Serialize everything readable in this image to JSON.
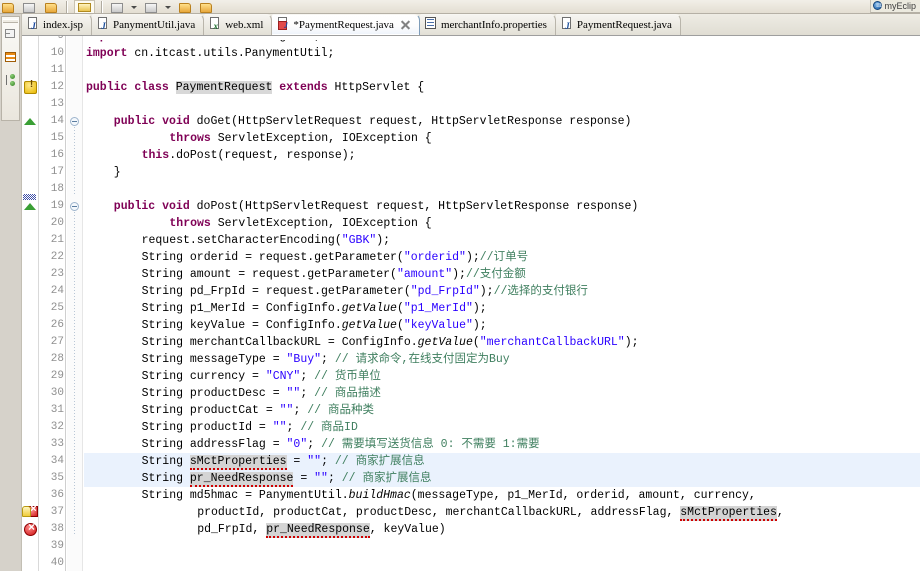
{
  "window": {
    "brand": "myEclip",
    "brand_icon": "myeclipse-globe-icon"
  },
  "toolbar": {
    "icons": [
      {
        "name": "open-folder-icon",
        "kind": "folder"
      },
      {
        "name": "new-wizard-icon",
        "kind": "gray"
      },
      {
        "name": "save-icon",
        "kind": "folder"
      },
      {
        "name": "edit-pencil-icon",
        "kind": "pencil"
      },
      {
        "name": "deploy-icon",
        "kind": "gray"
      },
      {
        "name": "server-icon",
        "kind": "gray"
      },
      {
        "name": "back-icon",
        "kind": "folder"
      },
      {
        "name": "forward-icon",
        "kind": "folder"
      }
    ]
  },
  "fastview": {
    "items": [
      {
        "name": "outline-view-icon",
        "kind": "outline"
      },
      {
        "name": "database-explorer-icon",
        "kind": "grid"
      },
      {
        "name": "package-explorer-icon",
        "kind": "tree"
      }
    ]
  },
  "tabs": [
    {
      "label": "index.jsp",
      "icon": "jsp-file-icon",
      "icon_kind": "jsp",
      "active": false,
      "dirty": false,
      "closable": false
    },
    {
      "label": "PanymentUtil.java",
      "icon": "java-file-icon",
      "icon_kind": "java",
      "active": false,
      "dirty": false,
      "closable": false
    },
    {
      "label": "web.xml",
      "icon": "xml-file-icon",
      "icon_kind": "xml",
      "active": false,
      "dirty": false,
      "closable": false
    },
    {
      "label": "*PaymentRequest.java",
      "icon": "java-file-dirty-icon",
      "icon_kind": "java-dirty",
      "active": true,
      "dirty": true,
      "closable": true
    },
    {
      "label": "merchantInfo.properties",
      "icon": "properties-file-icon",
      "icon_kind": "props",
      "active": false,
      "dirty": false,
      "closable": false
    },
    {
      "label": "PaymentRequest.java",
      "icon": "java-file-icon",
      "icon_kind": "java",
      "active": false,
      "dirty": false,
      "closable": false
    }
  ],
  "editor": {
    "first_line": 9,
    "last_line": 40,
    "highlighted_lines": [
      34,
      35
    ],
    "markers": [
      {
        "line": 12,
        "kind": "warning",
        "name": "warning-marker-icon"
      },
      {
        "line": 37,
        "kind": "error-quickfix",
        "name": "error-quickfix-marker-icon"
      },
      {
        "line": 38,
        "kind": "error",
        "name": "error-marker-icon"
      }
    ],
    "fold_markers": [
      14,
      19
    ],
    "override_markers": [
      14,
      19
    ],
    "lines": [
      {
        "n": 9,
        "indent": 0,
        "text": "import cn.itcast.utils.ConfigInfo;"
      },
      {
        "n": 10,
        "indent": 0,
        "text": "import cn.itcast.utils.PanymentUtil;"
      },
      {
        "n": 11,
        "indent": 0,
        "text": ""
      },
      {
        "n": 12,
        "indent": 0,
        "text": "public class PaymentRequest extends HttpServlet {"
      },
      {
        "n": 13,
        "indent": 0,
        "text": ""
      },
      {
        "n": 14,
        "indent": 1,
        "text": "public void doGet(HttpServletRequest request, HttpServletResponse response)"
      },
      {
        "n": 15,
        "indent": 3,
        "text": "throws ServletException, IOException {"
      },
      {
        "n": 16,
        "indent": 2,
        "text": "this.doPost(request, response);"
      },
      {
        "n": 17,
        "indent": 1,
        "text": "}"
      },
      {
        "n": 18,
        "indent": 0,
        "text": ""
      },
      {
        "n": 19,
        "indent": 1,
        "text": "public void doPost(HttpServletRequest request, HttpServletResponse response)"
      },
      {
        "n": 20,
        "indent": 3,
        "text": "throws ServletException, IOException {"
      },
      {
        "n": 21,
        "indent": 2,
        "text": "request.setCharacterEncoding(\"GBK\");"
      },
      {
        "n": 22,
        "indent": 2,
        "text": "String orderid = request.getParameter(\"orderid\");//订单号"
      },
      {
        "n": 23,
        "indent": 2,
        "text": "String amount = request.getParameter(\"amount\");//支付金额"
      },
      {
        "n": 24,
        "indent": 2,
        "text": "String pd_FrpId = request.getParameter(\"pd_FrpId\");//选择的支付银行"
      },
      {
        "n": 25,
        "indent": 2,
        "text": "String p1_MerId = ConfigInfo.getValue(\"p1_MerId\");"
      },
      {
        "n": 26,
        "indent": 2,
        "text": "String keyValue = ConfigInfo.getValue(\"keyValue\");"
      },
      {
        "n": 27,
        "indent": 2,
        "text": "String merchantCallbackURL = ConfigInfo.getValue(\"merchantCallbackURL\");"
      },
      {
        "n": 28,
        "indent": 2,
        "text": "String messageType = \"Buy\"; // 请求命令,在线支付固定为Buy"
      },
      {
        "n": 29,
        "indent": 2,
        "text": "String currency = \"CNY\"; // 货币单位"
      },
      {
        "n": 30,
        "indent": 2,
        "text": "String productDesc = \"\"; // 商品描述"
      },
      {
        "n": 31,
        "indent": 2,
        "text": "String productCat = \"\"; // 商品种类"
      },
      {
        "n": 32,
        "indent": 2,
        "text": "String productId = \"\"; // 商品ID"
      },
      {
        "n": 33,
        "indent": 2,
        "text": "String addressFlag = \"0\"; // 需要填写送货信息 0: 不需要 1:需要"
      },
      {
        "n": 34,
        "indent": 2,
        "text": "String sMctProperties = \"\"; // 商家扩展信息"
      },
      {
        "n": 35,
        "indent": 2,
        "text": "String pr_NeedResponse = \"\"; // 商家扩展信息"
      },
      {
        "n": 36,
        "indent": 2,
        "text": "String md5hmac = PanymentUtil.buildHmac(messageType, p1_MerId, orderid, amount, currency,"
      },
      {
        "n": 37,
        "indent": 4,
        "text": "productId, productCat, productDesc, merchantCallbackURL, addressFlag, sMctProperties,"
      },
      {
        "n": 38,
        "indent": 4,
        "text": "pd_FrpId, pr_NeedResponse, keyValue)"
      },
      {
        "n": 39,
        "indent": 0,
        "text": ""
      },
      {
        "n": 40,
        "indent": 0,
        "text": ""
      }
    ],
    "colors": {
      "keyword": "#7f0055",
      "string": "#2a00ff",
      "comment": "#3f7f5f",
      "field": "#0000c0",
      "error_underline": "#cf0000",
      "line_highlight": "#eaf2fd",
      "occurrence_highlight": "#d4d4d4"
    }
  }
}
